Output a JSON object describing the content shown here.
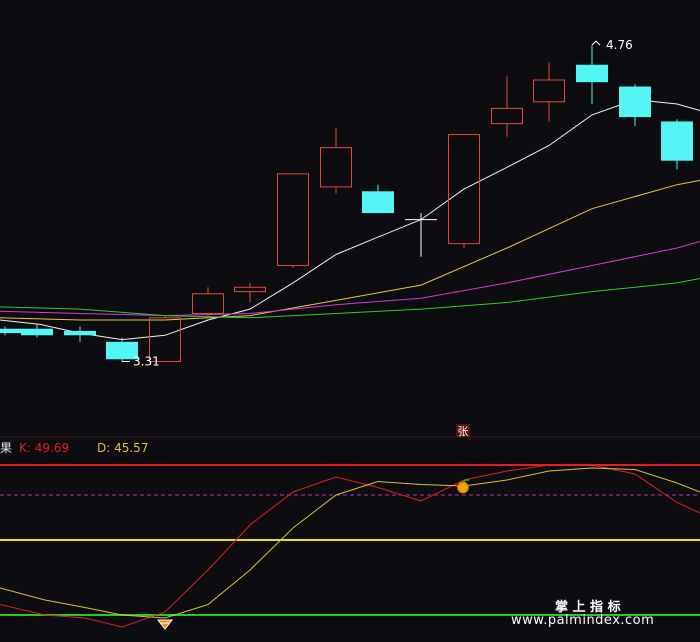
{
  "chart_data": [
    {
      "type": "candlestick",
      "panel": "price",
      "ylim": [
        2.95,
        4.93
      ],
      "candles": [
        {
          "x": 5,
          "open": 3.46,
          "close": 3.44,
          "high": 3.47,
          "low": 3.43
        },
        {
          "x": 37,
          "open": 3.46,
          "close": 3.43,
          "high": 3.48,
          "low": 3.42
        },
        {
          "x": 80,
          "open": 3.45,
          "close": 3.43,
          "high": 3.47,
          "low": 3.4
        },
        {
          "x": 122,
          "open": 3.4,
          "close": 3.32,
          "high": 3.42,
          "low": 3.31
        },
        {
          "x": 165,
          "open": 3.31,
          "close": 3.51,
          "high": 3.52,
          "low": 3.31
        },
        {
          "x": 208,
          "open": 3.53,
          "close": 3.62,
          "high": 3.65,
          "low": 3.51
        },
        {
          "x": 250,
          "open": 3.63,
          "close": 3.65,
          "high": 3.67,
          "low": 3.58
        },
        {
          "x": 293,
          "open": 3.75,
          "close": 4.17,
          "high": 4.17,
          "low": 3.74
        },
        {
          "x": 336,
          "open": 4.11,
          "close": 4.29,
          "high": 4.38,
          "low": 4.08
        },
        {
          "x": 378,
          "open": 4.09,
          "close": 3.99,
          "high": 4.12,
          "low": 3.99
        },
        {
          "x": 421,
          "open": 3.96,
          "close": 3.96,
          "high": 3.99,
          "low": 3.79
        },
        {
          "x": 464,
          "open": 3.85,
          "close": 4.35,
          "high": 4.35,
          "low": 3.83
        },
        {
          "x": 507,
          "open": 4.4,
          "close": 4.47,
          "high": 4.62,
          "low": 4.34
        },
        {
          "x": 549,
          "open": 4.5,
          "close": 4.6,
          "high": 4.68,
          "low": 4.41
        },
        {
          "x": 592,
          "open": 4.67,
          "close": 4.59,
          "high": 4.76,
          "low": 4.49
        },
        {
          "x": 635,
          "open": 4.57,
          "close": 4.43,
          "high": 4.58,
          "low": 4.39
        },
        {
          "x": 677,
          "open": 4.41,
          "close": 4.23,
          "high": 4.42,
          "low": 4.19
        }
      ],
      "annotations": [
        {
          "text": "3.31",
          "x": 122,
          "value": 3.31,
          "type": "low"
        },
        {
          "text": "4.76",
          "x": 592,
          "value": 4.76,
          "type": "high"
        }
      ],
      "series": [
        {
          "color": "#f2f2f2",
          "points": [
            [
              0,
              3.5
            ],
            [
              40,
              3.48
            ],
            [
              80,
              3.44
            ],
            [
              122,
              3.41
            ],
            [
              165,
              3.43
            ],
            [
              208,
              3.5
            ],
            [
              250,
              3.55
            ],
            [
              293,
              3.67
            ],
            [
              336,
              3.8
            ],
            [
              378,
              3.88
            ],
            [
              421,
              3.96
            ],
            [
              464,
              4.1
            ],
            [
              507,
              4.2
            ],
            [
              549,
              4.3
            ],
            [
              592,
              4.44
            ],
            [
              635,
              4.51
            ],
            [
              677,
              4.49
            ],
            [
              700,
              4.46
            ]
          ]
        },
        {
          "color": "#e6c84a",
          "points": [
            [
              0,
              3.51
            ],
            [
              80,
              3.5
            ],
            [
              165,
              3.5
            ],
            [
              250,
              3.52
            ],
            [
              336,
              3.59
            ],
            [
              421,
              3.66
            ],
            [
              507,
              3.83
            ],
            [
              592,
              4.01
            ],
            [
              677,
              4.12
            ],
            [
              700,
              4.14
            ]
          ]
        },
        {
          "color": "#d63ad6",
          "points": [
            [
              0,
              3.54
            ],
            [
              80,
              3.53
            ],
            [
              165,
              3.52
            ],
            [
              250,
              3.53
            ],
            [
              336,
              3.57
            ],
            [
              421,
              3.6
            ],
            [
              507,
              3.67
            ],
            [
              592,
              3.75
            ],
            [
              677,
              3.83
            ],
            [
              700,
              3.86
            ]
          ]
        },
        {
          "color": "#33cc33",
          "points": [
            [
              0,
              3.56
            ],
            [
              80,
              3.55
            ],
            [
              165,
              3.52
            ],
            [
              250,
              3.51
            ],
            [
              336,
              3.53
            ],
            [
              421,
              3.55
            ],
            [
              507,
              3.58
            ],
            [
              592,
              3.63
            ],
            [
              677,
              3.67
            ],
            [
              700,
              3.69
            ]
          ]
        }
      ],
      "marker": {
        "text": "张",
        "x": 463
      }
    },
    {
      "type": "line",
      "panel": "indicator",
      "ylim": [
        -10,
        110
      ],
      "reference_lines": [
        {
          "value": 100,
          "color": "#e02020"
        },
        {
          "value": 80,
          "color": "#b03aaa",
          "style": "dashed"
        },
        {
          "value": 50,
          "color": "#e8e020"
        },
        {
          "value": 0,
          "color": "#22cc22"
        }
      ],
      "series": [
        {
          "name": "K",
          "color": "#e02020",
          "points": [
            [
              0,
              7
            ],
            [
              45,
              0
            ],
            [
              85,
              -2
            ],
            [
              122,
              -8
            ],
            [
              165,
              2
            ],
            [
              208,
              30
            ],
            [
              250,
              60
            ],
            [
              293,
              82
            ],
            [
              336,
              92
            ],
            [
              378,
              85
            ],
            [
              421,
              76
            ],
            [
              464,
              90
            ],
            [
              507,
              96
            ],
            [
              549,
              100
            ],
            [
              592,
              100
            ],
            [
              635,
              94
            ],
            [
              677,
              75
            ],
            [
              700,
              68
            ]
          ]
        },
        {
          "name": "D",
          "color": "#d4c23a",
          "points": [
            [
              0,
              18
            ],
            [
              45,
              10
            ],
            [
              85,
              5
            ],
            [
              122,
              0
            ],
            [
              165,
              -2
            ],
            [
              208,
              7
            ],
            [
              250,
              30
            ],
            [
              293,
              58
            ],
            [
              336,
              80
            ],
            [
              378,
              89
            ],
            [
              421,
              87
            ],
            [
              464,
              86
            ],
            [
              507,
              90
            ],
            [
              549,
              96
            ],
            [
              592,
              98
            ],
            [
              635,
              97
            ],
            [
              677,
              88
            ],
            [
              700,
              82
            ]
          ]
        }
      ],
      "markers": [
        {
          "icon": "orange-fruit-icon",
          "x": 463,
          "value": 85
        },
        {
          "icon": "orange-diamond-icon",
          "x": 165,
          "value": -6
        }
      ]
    }
  ],
  "indicator_header": {
    "name": "果",
    "k_text": "K: 49.69",
    "d_text": "D: 45.57",
    "k_color": "#e02020",
    "d_color": "#e0c030"
  },
  "colors": {
    "background": "#0d0c10",
    "up": "#e04a3a",
    "down": "#54f5f5",
    "divider": "#3a1a1a"
  },
  "watermark": {
    "title": "掌 上 指 标",
    "url": "www.palmindex.com"
  }
}
